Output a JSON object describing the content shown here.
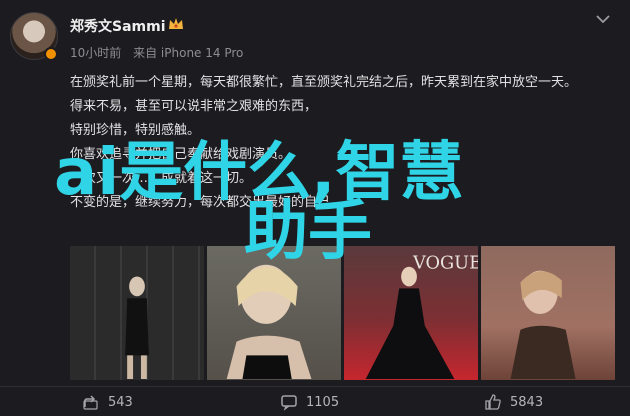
{
  "author": {
    "name": "郑秀文Sammi",
    "time": "10小时前",
    "source": "来自 iPhone 14 Pro"
  },
  "post": {
    "lines": [
      "在颁奖礼前一个星期，每天都很繁忙，直至颁奖礼完结之后，昨天累到在家中放空一天。",
      "得来不易，甚至可以说非常之艰难的东西，",
      "特别珍惜，特别感触。",
      "你喜欢追寻并把自己奉献给戏剧演员。",
      "一次又一次……成就着这一切。",
      "不变的是，继续努力，每次都交出最好的自己。"
    ]
  },
  "overlay": {
    "line1": "ai是什么,智慧",
    "line2": "助手"
  },
  "photos": [
    {
      "label": "photo-1"
    },
    {
      "label": "photo-2"
    },
    {
      "label": "photo-3",
      "caption": "VOGUE"
    },
    {
      "label": "photo-4"
    }
  ],
  "actions": {
    "share_count": "543",
    "comment_count": "1105",
    "like_count": "5843"
  },
  "colors": {
    "overlay": "#2fd5e6",
    "vip": "#f29100"
  }
}
